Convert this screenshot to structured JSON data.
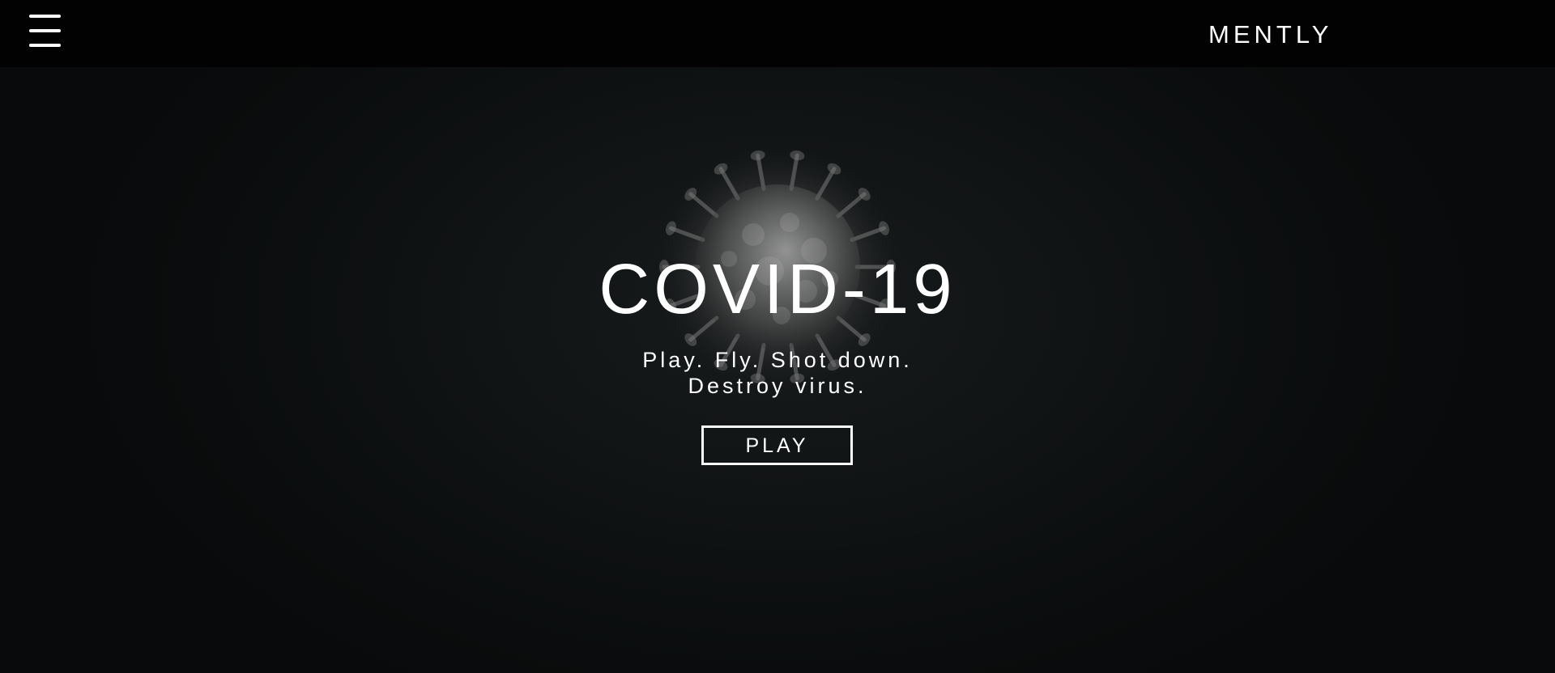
{
  "header": {
    "menu_icon": "hamburger-menu-icon",
    "brand": "MENTLY"
  },
  "hero": {
    "background_image": "coronavirus-particle",
    "title": "COVID-19",
    "tagline_line1": "Play. Fly. Shot down.",
    "tagline_line2": "Destroy virus.",
    "play_label": "PLAY"
  },
  "colors": {
    "topbar": "#020202",
    "background": "#0b0d0e",
    "text": "#ffffff"
  }
}
